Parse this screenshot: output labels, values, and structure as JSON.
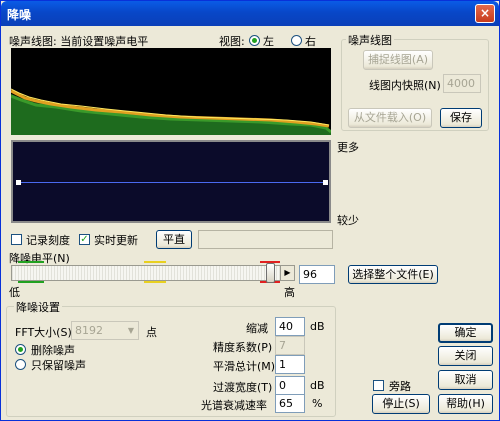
{
  "window": {
    "title": "降噪",
    "close": "×"
  },
  "graph": {
    "caption": "噪声线图: 当前设置噪声电平",
    "view_label": "视图:",
    "left": "左",
    "right": "右"
  },
  "noise_group": {
    "title": "噪声线图",
    "capture": "捕捉线图(A)",
    "snapshots_label": "线图内快照(N)",
    "snapshots_value": "4000",
    "load": "从文件载入(O)",
    "save": "保存"
  },
  "side": {
    "more": "更多",
    "less": "较少"
  },
  "options": {
    "log_scale": "记录刻度",
    "live_update": "实时更新",
    "flat": "平直"
  },
  "level": {
    "label": "降噪电平(N)",
    "value": "96",
    "low": "低",
    "high": "高",
    "select_file": "选择整个文件(E)"
  },
  "settings": {
    "title": "降噪设置",
    "fft_label": "FFT大小(S)",
    "fft_value": "8192",
    "points": "点",
    "remove": "删除噪声",
    "keep": "只保留噪声",
    "reduce_label": "缩减",
    "reduce_value": "40",
    "db": "dB",
    "precision_label": "精度系数(P)",
    "precision_value": "7",
    "smoothing_label": "平滑总计(M)",
    "smoothing_value": "1",
    "transition_label": "过渡宽度(T)",
    "transition_value": "0",
    "db2": "dB",
    "decay_label": "光谱衰减速率",
    "decay_value": "65",
    "percent": "%"
  },
  "buttons": {
    "ok": "确定",
    "close": "关闭",
    "cancel": "取消",
    "bypass": "旁路",
    "stop": "停止(S)",
    "help": "帮助(H)"
  }
}
